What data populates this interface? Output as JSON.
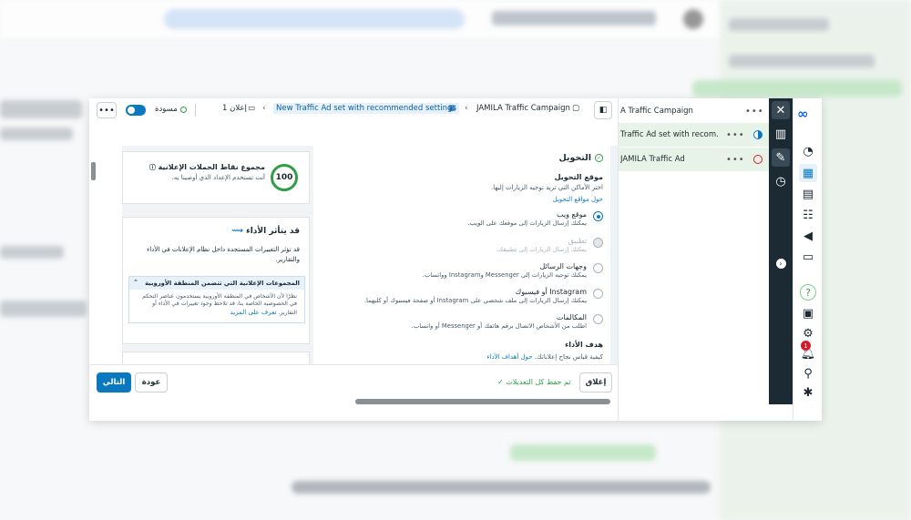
{
  "topbar": {
    "draft_label": "مسودة",
    "ads_count": "1 إعلان",
    "breadcrumb_adset": "New Traffic Ad set with recommended settings",
    "breadcrumb_campaign": "JAMILA Traffic Campaign"
  },
  "tree": {
    "items": [
      {
        "label": "A Traffic Campaign",
        "status": "none"
      },
      {
        "label": "Traffic Ad set with recom...",
        "status": "half"
      },
      {
        "label": "JAMILA Traffic Ad",
        "status": "error"
      }
    ]
  },
  "score": {
    "value": "100",
    "title": "مجموع نقاط الحملات الإعلانية",
    "subtitle": "أنت تستخدم الإعداد الذي أوصينا به."
  },
  "performance": {
    "title": "قد يتأثر الأداء",
    "body": "قد تؤثر التغييرات المستجدة داخل نظام الإعلانات في الأداء والتقارير.",
    "eu_title": "المجموعات الإعلانية التي تتضمن المنطقة الأوروبية",
    "eu_body": "نظرًا لأن الأشخاص في المنطقة الأوروبية يستخدمون عناصر التحكم في الخصوصية الخاصة بنا، قد تلاحظ وجود تغييرات في الأداء أو التقارير.",
    "eu_link": "تعرف على المزيد"
  },
  "conversion": {
    "title": "التحويل",
    "location_title": "موقع التحويل",
    "location_desc": "اختر الأماكن التي تريد توجيه الزيارات إليها.",
    "location_link": "حول مواقع التحويل",
    "options": [
      {
        "title": "موقع ويب",
        "desc": "يمكنك إرسال الزيارات إلى موقعك على الويب.",
        "selected": true,
        "disabled": false
      },
      {
        "title": "تطبيق",
        "desc": "يمكنك إرسال الزيارات إلى تطبيقك.",
        "selected": false,
        "disabled": true
      },
      {
        "title": "وجهات الرسائل",
        "desc": "يمكنك توجيه الزيارات إلى Messenger وInstagram وواتساب.",
        "selected": false,
        "disabled": false
      },
      {
        "title": "Instagram أو فيسبوك",
        "desc": "يمكنك إرسال الزيارات إلى ملف شخصي على Instagram أو صفحة فيسبوك أو كليهما.",
        "selected": false,
        "disabled": false
      },
      {
        "title": "المكالمات",
        "desc": "اطلب من الأشخاص الاتصال برقم هاتفك أو Messenger أو واتساب.",
        "selected": false,
        "disabled": false
      }
    ],
    "goal_title": "هدف الأداء",
    "goal_desc": "كيفية قياس نجاح إعلاناتك.",
    "goal_link": "حول أهداف الأداء"
  },
  "footer": {
    "next": "التالي",
    "back": "عودة",
    "saved": "تم حفظ كل التعديلات",
    "close": "إغلاق"
  },
  "colors": {
    "primary": "#0a78be",
    "success": "#2f9e45",
    "rail_dark": "#1c2b33",
    "error": "#d81b2a"
  }
}
